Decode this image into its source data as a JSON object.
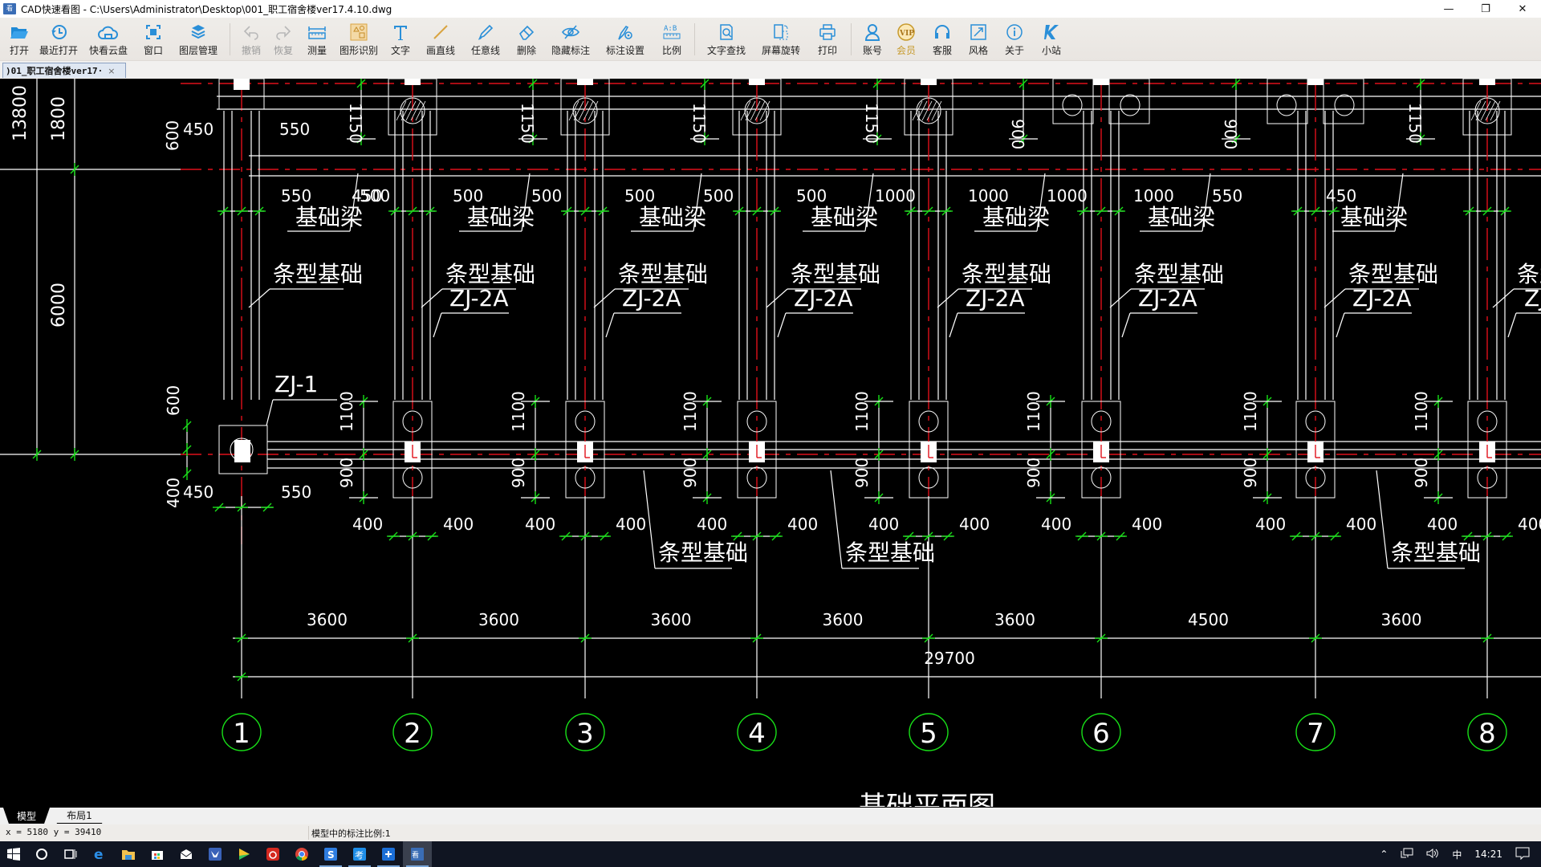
{
  "window": {
    "app_icon": "cad-app-icon",
    "title": "CAD快速看图 - C:\\Users\\Administrator\\Desktop\\001_职工宿舍楼ver17.4.10.dwg",
    "minimize": "—",
    "restore": "❐",
    "close": "✕"
  },
  "toolbar": {
    "items": [
      {
        "label": "打开",
        "icon": "folder-open-icon",
        "state": "enabled"
      },
      {
        "label": "最近打开",
        "icon": "history-clock-icon",
        "state": "enabled"
      },
      {
        "label": "快看云盘",
        "icon": "cloud-drive-icon",
        "state": "enabled"
      },
      {
        "label": "窗口",
        "icon": "window-frame-icon",
        "state": "enabled"
      },
      {
        "label": "图层管理",
        "icon": "layers-icon",
        "state": "enabled"
      },
      {
        "label": "撤销",
        "icon": "undo-icon",
        "state": "disabled"
      },
      {
        "label": "恢复",
        "icon": "redo-icon",
        "state": "disabled"
      },
      {
        "label": "测量",
        "icon": "ruler-measure-icon",
        "state": "enabled"
      },
      {
        "label": "图形识别",
        "icon": "shape-recognition-icon",
        "state": "enabled"
      },
      {
        "label": "文字",
        "icon": "text-t-icon",
        "state": "enabled"
      },
      {
        "label": "画直线",
        "icon": "line-draw-icon",
        "state": "enabled"
      },
      {
        "label": "任意线",
        "icon": "freehand-pen-icon",
        "state": "enabled"
      },
      {
        "label": "删除",
        "icon": "eraser-icon",
        "state": "enabled"
      },
      {
        "label": "隐藏标注",
        "icon": "hide-eye-icon",
        "state": "enabled"
      },
      {
        "label": "标注设置",
        "icon": "annotation-settings-icon",
        "state": "enabled"
      },
      {
        "label": "比例",
        "icon": "scale-ab-icon",
        "state": "enabled"
      },
      {
        "label": "文字查找",
        "icon": "text-search-icon",
        "state": "enabled"
      },
      {
        "label": "屏幕旋转",
        "icon": "screen-rotate-icon",
        "state": "enabled"
      },
      {
        "label": "打印",
        "icon": "printer-icon",
        "state": "enabled"
      },
      {
        "label": "账号",
        "icon": "account-user-icon",
        "state": "enabled"
      },
      {
        "label": "会员",
        "icon": "vip-badge-icon",
        "state": "vip"
      },
      {
        "label": "客服",
        "icon": "headset-icon",
        "state": "enabled"
      },
      {
        "label": "风格",
        "icon": "style-frame-icon",
        "state": "enabled"
      },
      {
        "label": "关于",
        "icon": "info-icon",
        "state": "enabled"
      },
      {
        "label": "小站",
        "icon": "k-site-icon",
        "state": "enabled"
      }
    ]
  },
  "document_tab": {
    "label": ")01_职工宿舍楼ver17·",
    "close": "×"
  },
  "drawing": {
    "axis_labels": [
      "1",
      "2",
      "3",
      "4",
      "5",
      "6",
      "7",
      "8"
    ],
    "bay_dimensions": [
      "3600",
      "3600",
      "3600",
      "3600",
      "3600",
      "4500",
      "3600"
    ],
    "overall_dimension": "29700",
    "left_dimensions": {
      "overall": "13800",
      "top_segment": "1800",
      "middle_segment": "6000",
      "upper_offset": "600",
      "lower_offset_top": "600",
      "lower_offset_bottom": "400"
    },
    "labels": {
      "strip_foundation": "条型基础",
      "foundation_beam": "基础梁",
      "footing_zj1": "ZJ-1",
      "footing_zj2a": "ZJ-2A"
    },
    "top_beam_dims": [
      [
        "450",
        "550"
      ],
      [
        "550",
        "500"
      ],
      [
        "500",
        "500"
      ],
      [
        "500",
        "500"
      ],
      [
        "500",
        "1000"
      ],
      [
        "1000",
        "1000"
      ],
      [
        "1000",
        "550"
      ],
      [
        "450",
        ""
      ]
    ],
    "upper_vertical_dims": [
      "1150",
      "1150",
      "1150",
      "1150",
      "900",
      "900",
      "1150"
    ],
    "lower_vertical_dims": {
      "top": "1100",
      "bottom": "900"
    },
    "footing_width_dims": [
      "400",
      "400"
    ],
    "zj1_dims": {
      "left": "450",
      "right": "550"
    },
    "drawing_title": "基础平面图"
  },
  "layout_tabs": [
    {
      "label": "模型",
      "active": true
    },
    {
      "label": "布局1",
      "active": false
    }
  ],
  "statusbar": {
    "coordinates": "x = 5180  y = 39410",
    "annotation_scale": "模型中的标注比例:1"
  },
  "taskbar": {
    "items": [
      {
        "icon": "windows-start-icon"
      },
      {
        "icon": "cortana-search-icon"
      },
      {
        "icon": "task-view-icon"
      },
      {
        "icon": "edge-browser-icon"
      },
      {
        "icon": "file-explorer-icon"
      },
      {
        "icon": "store-icon"
      },
      {
        "icon": "mail-icon"
      },
      {
        "icon": "app-swallow-icon"
      },
      {
        "icon": "video-player-icon"
      },
      {
        "icon": "netease-music-icon"
      },
      {
        "icon": "chrome-icon"
      },
      {
        "icon": "app-blue-s-icon",
        "running": true
      },
      {
        "icon": "app-kao-icon",
        "running": true
      },
      {
        "icon": "app-blue-e-icon",
        "running": true
      },
      {
        "icon": "cad-viewer-taskbar-icon",
        "running": true,
        "active": true
      }
    ],
    "tray": {
      "ime": "中",
      "time": "14:21"
    }
  },
  "colors": {
    "canvas_bg": "#000000",
    "cad_white": "#ffffff",
    "axis_red": "#e0101a",
    "dim_green": "#18e018",
    "toolbar_icon_blue": "#2a8fd8",
    "vip_gold": "#c79a2c"
  }
}
